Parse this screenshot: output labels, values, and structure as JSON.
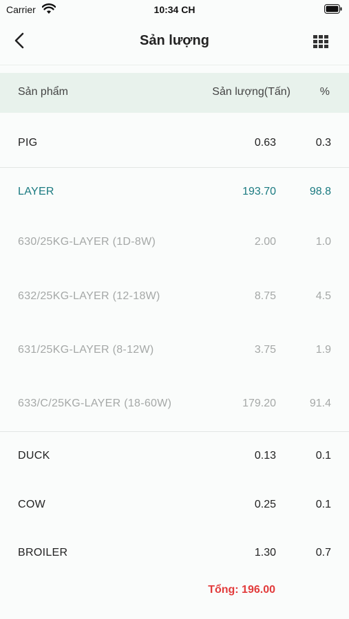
{
  "status_bar": {
    "carrier": "Carrier",
    "time": "10:34 CH"
  },
  "nav": {
    "title": "Sản lượng",
    "back_icon": "chevron-left-icon",
    "grid_icon": "grid-icon"
  },
  "table": {
    "headers": {
      "product": "Sản phẩm",
      "output": "Sản lượng(Tấn)",
      "percent": "%"
    },
    "rows": [
      {
        "name": "PIG",
        "value": "0.63",
        "percent": "0.3"
      },
      {
        "name": "LAYER",
        "value": "193.70",
        "percent": "98.8"
      },
      {
        "name": "630/25KG-LAYER (1D-8W)",
        "value": "2.00",
        "percent": "1.0"
      },
      {
        "name": "632/25KG-LAYER (12-18W)",
        "value": "8.75",
        "percent": "4.5"
      },
      {
        "name": "631/25KG-LAYER (8-12W)",
        "value": "3.75",
        "percent": "1.9"
      },
      {
        "name": "633/C/25KG-LAYER (18-60W)",
        "value": "179.20",
        "percent": "91.4"
      },
      {
        "name": "DUCK",
        "value": "0.13",
        "percent": "0.1"
      },
      {
        "name": "COW",
        "value": "0.25",
        "percent": "0.1"
      },
      {
        "name": "BROILER",
        "value": "1.30",
        "percent": "0.7"
      }
    ],
    "total": "Tổng: 196.00"
  },
  "colors": {
    "accent": "#1a7a80",
    "total": "#e23b3b",
    "header_bg": "#e8f2ec",
    "muted": "#a5a8a7"
  }
}
